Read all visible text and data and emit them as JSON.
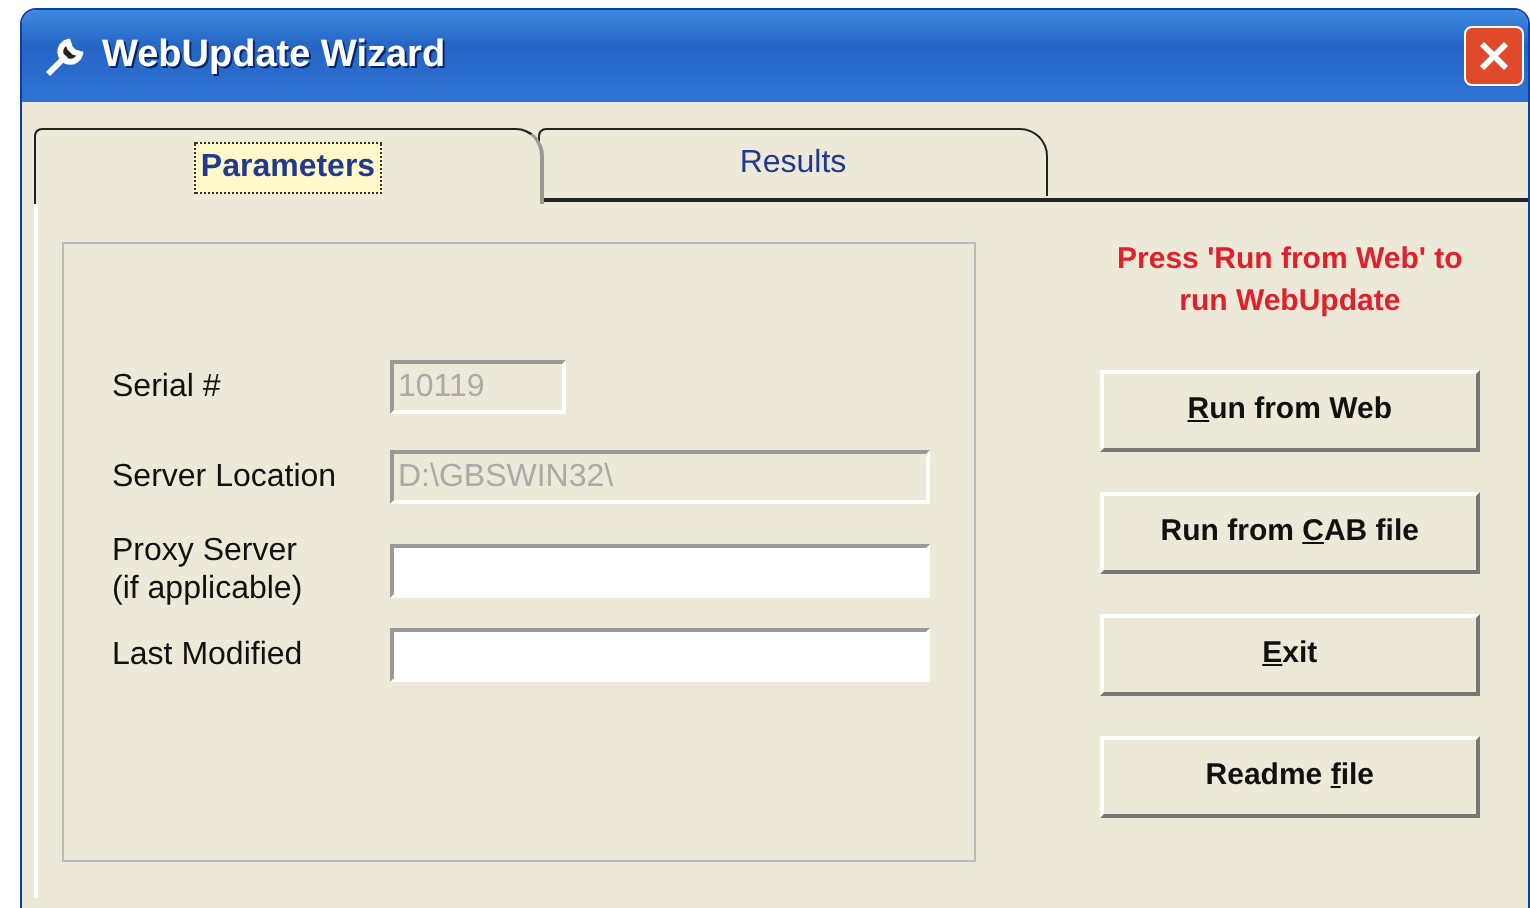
{
  "window": {
    "title": "WebUpdate Wizard"
  },
  "tabs": [
    {
      "label": "Parameters",
      "selected": true
    },
    {
      "label": "Results",
      "selected": false
    }
  ],
  "fields": [
    {
      "label": "Serial #",
      "value": "10119",
      "disabled": true,
      "kind": "short"
    },
    {
      "label": "Server Location",
      "value": "D:\\GBSWIN32\\",
      "disabled": true,
      "kind": "wide"
    },
    {
      "label": "Proxy Server\n(if applicable)",
      "disabled": false,
      "kind": "wide"
    },
    {
      "label": "Last Modified",
      "disabled": false,
      "kind": "wide"
    }
  ],
  "instruction": "Press 'Run from Web' to\nrun WebUpdate",
  "buttons": [
    {
      "key": "R",
      "after": "un from Web"
    },
    {
      "before": "Run from ",
      "key": "C",
      "after": "AB file"
    },
    {
      "key": "E",
      "after": "xit"
    },
    {
      "before": "Readme ",
      "key": "f",
      "after": "ile"
    }
  ]
}
